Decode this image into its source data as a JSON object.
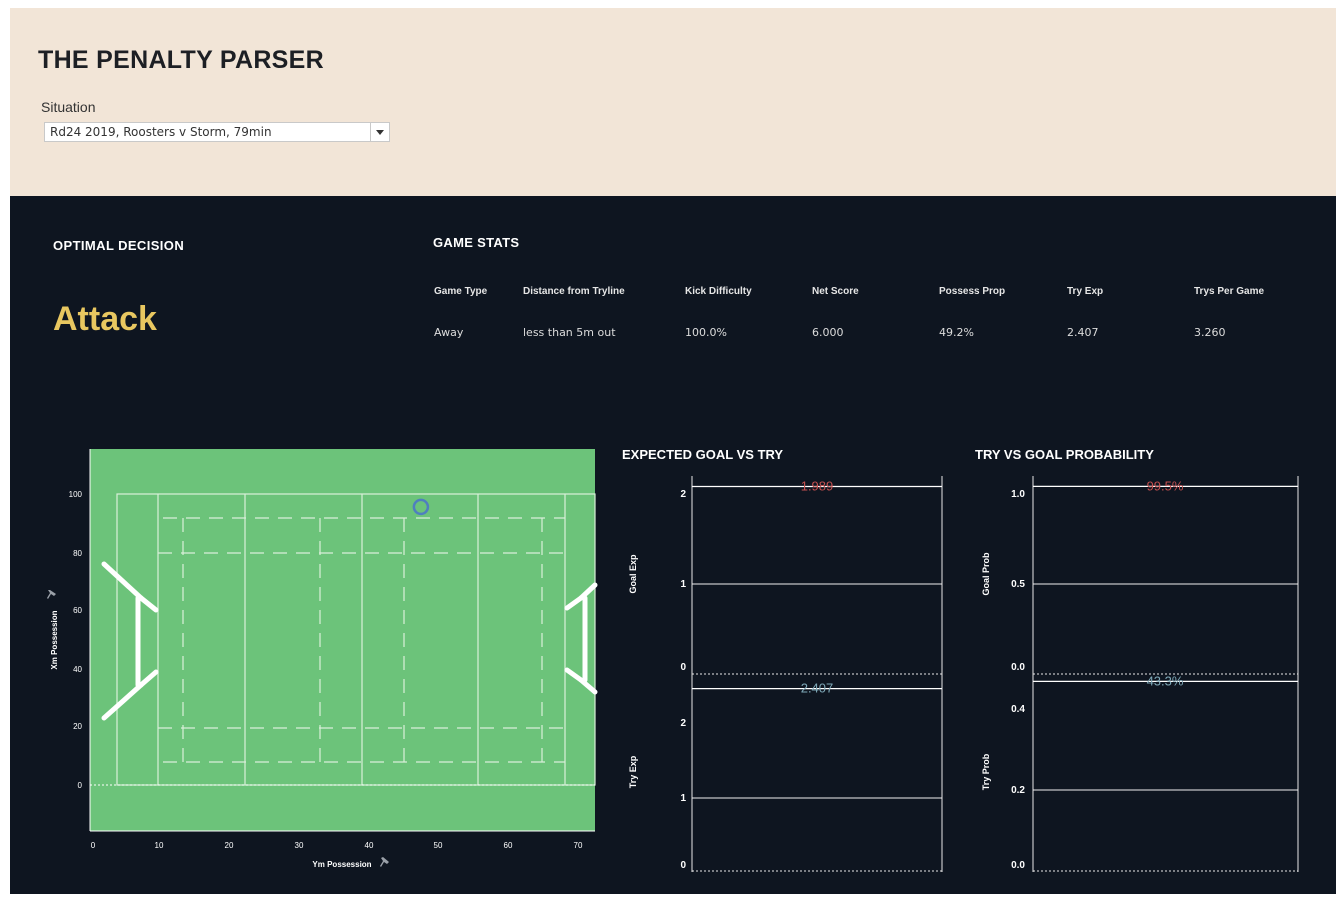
{
  "header": {
    "title": "THE PENALTY PARSER",
    "situation_label": "Situation",
    "situation_value": "Rd24 2019, Roosters v Storm, 79min"
  },
  "optimal": {
    "heading": "OPTIMAL DECISION",
    "decision": "Attack"
  },
  "game_stats": {
    "heading": "GAME STATS",
    "columns": [
      "Game Type",
      "Distance from Tryline",
      "Kick Difficulty",
      "Net Score",
      "Possess Prop",
      "Try Exp",
      "Trys Per Game"
    ],
    "values": [
      "Away",
      "less than 5m out",
      "100.0%",
      "6.000",
      "49.2%",
      "2.407",
      "3.260"
    ]
  },
  "field": {
    "y_ticks": [
      "100",
      "80",
      "60",
      "40",
      "20",
      "0"
    ],
    "x_ticks": [
      "0",
      "10",
      "20",
      "30",
      "40",
      "50",
      "60",
      "70"
    ],
    "y_axis_label": "Xm Possession",
    "x_axis_label": "Ym Possession",
    "position": {
      "x": 47,
      "y": 96
    },
    "xlim": [
      -0.5,
      72
    ],
    "ylim": [
      -16,
      116
    ]
  },
  "colors": {
    "field_green": "#6cc37a",
    "dark_bg": "#0e1520",
    "goal_red": "#c4504f",
    "try_blue": "#7fa9b8",
    "accent_gold": "#e8c760"
  },
  "chart_data": [
    {
      "type": "bar",
      "title": "EXPECTED GOAL VS TRY",
      "panels": [
        {
          "ylabel": "Goal Exp",
          "yticks": [
            "2",
            "1",
            "0"
          ],
          "ylim": [
            0,
            2.1
          ],
          "value": 1.989,
          "value_label": "1.989"
        },
        {
          "ylabel": "Try Exp",
          "yticks": [
            "2",
            "1",
            "0"
          ],
          "ylim": [
            0,
            2.6
          ],
          "value": 2.407,
          "value_label": "2.407"
        }
      ]
    },
    {
      "type": "bar",
      "title": "TRY VS GOAL PROBABILITY",
      "panels": [
        {
          "ylabel": "Goal Prob",
          "yticks": [
            "1.0",
            "0.5",
            "0.0"
          ],
          "ylim": [
            0,
            1.05
          ],
          "value": 0.995,
          "value_label": "99.5%"
        },
        {
          "ylabel": "Try Prob",
          "yticks": [
            "0.4",
            "0.2",
            "0.0"
          ],
          "ylim": [
            0,
            0.45
          ],
          "value": 0.433,
          "value_label": "43.3%"
        }
      ]
    }
  ]
}
